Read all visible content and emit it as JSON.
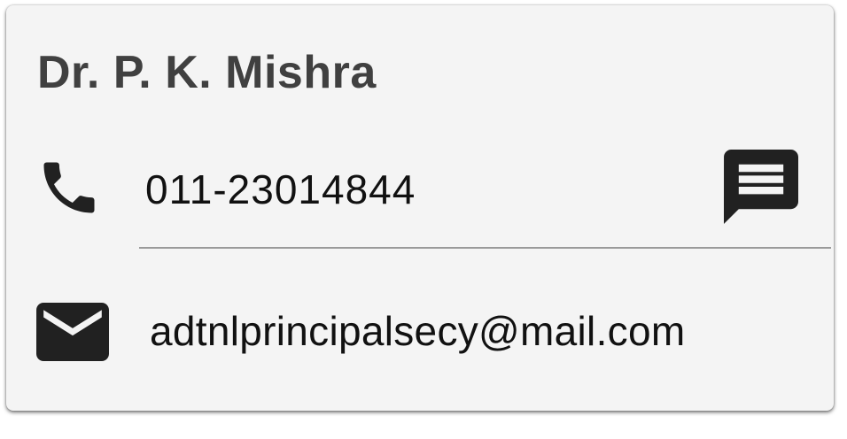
{
  "contact": {
    "name": "Dr. P. K. Mishra",
    "phone": "011-23014844",
    "email": "adtnlprincipalsecy@mail.com"
  },
  "icons": {
    "phone": "phone-icon",
    "message": "message-icon",
    "email": "email-icon"
  },
  "colors": {
    "card_background": "#f4f4f4",
    "name_text": "#404040",
    "value_text": "#111111",
    "icon": "#212121",
    "divider": "#9a9a9a"
  }
}
